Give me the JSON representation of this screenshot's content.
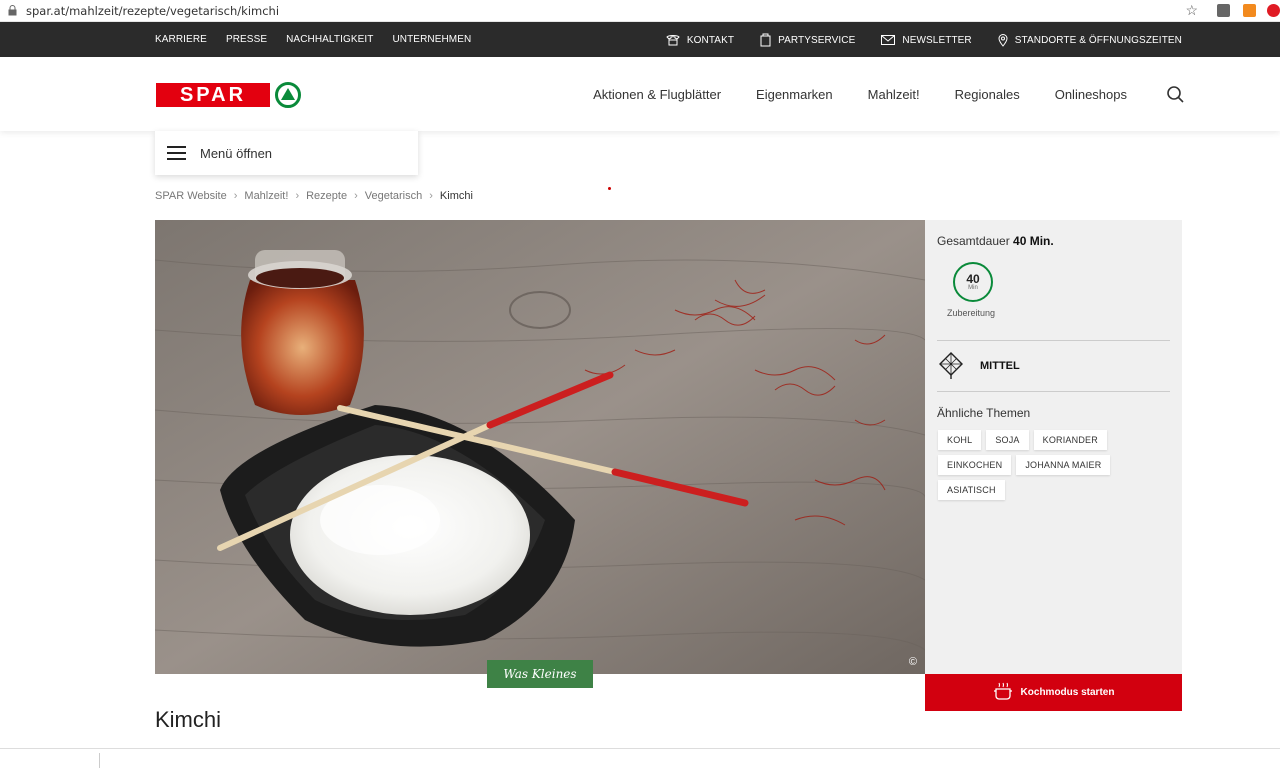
{
  "browser": {
    "url": "spar.at/mahlzeit/rezepte/vegetarisch/kimchi"
  },
  "topbar": {
    "left_links": [
      "KARRIERE",
      "PRESSE",
      "NACHHALTIGKEIT",
      "UNTERNEHMEN"
    ],
    "right_links": [
      {
        "label": "KONTAKT",
        "icon": "phone-icon"
      },
      {
        "label": "PARTYSERVICE",
        "icon": "bag-icon"
      },
      {
        "label": "NEWSLETTER",
        "icon": "mail-icon"
      },
      {
        "label": "STANDORTE & ÖFFNUNGSZEITEN",
        "icon": "location-icon"
      }
    ]
  },
  "header": {
    "logo_text": "SPAR",
    "nav": [
      "Aktionen & Flugblätter",
      "Eigenmarken",
      "Mahlzeit!",
      "Regionales",
      "Onlineshops"
    ]
  },
  "menu": {
    "label": "Menü öffnen"
  },
  "breadcrumb": [
    "SPAR Website",
    "Mahlzeit!",
    "Rezepte",
    "Vegetarisch",
    "Kimchi"
  ],
  "hero": {
    "copyright": "©",
    "badge": "Was Kleines"
  },
  "sidebar": {
    "duration_label": "Gesamtdauer",
    "duration_value": "40 Min.",
    "prep_minutes": "40",
    "prep_unit": "Min",
    "prep_label": "Zubereitung",
    "difficulty": "MITTEL",
    "themes_label": "Ähnliche Themen",
    "tags": [
      "KOHL",
      "SOJA",
      "KORIANDER",
      "EINKOCHEN",
      "JOHANNA MAIER",
      "ASIATISCH"
    ],
    "cook_button": "Kochmodus starten"
  },
  "recipe": {
    "title": "Kimchi"
  },
  "colors": {
    "brand_red": "#e3000f",
    "brand_green": "#0a8a3a",
    "badge_green": "#3e8246",
    "topbar": "#2b2b2b"
  }
}
